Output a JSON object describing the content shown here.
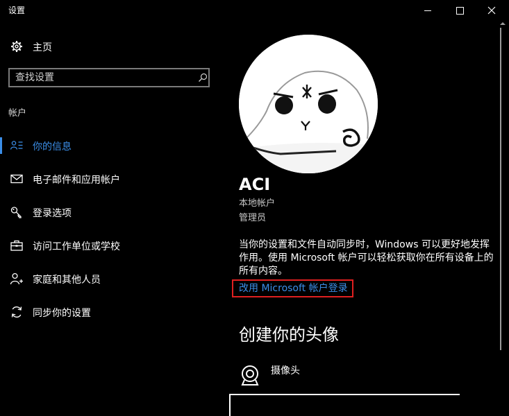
{
  "window": {
    "title": "设置"
  },
  "sidebar": {
    "home_label": "主页",
    "search": {
      "placeholder": "查找设置",
      "icon": "search-icon"
    },
    "section_title": "帐户",
    "items": [
      {
        "label": "你的信息",
        "icon": "person-card-icon",
        "active": true
      },
      {
        "label": "电子邮件和应用帐户",
        "icon": "mail-icon",
        "active": false
      },
      {
        "label": "登录选项",
        "icon": "key-icon",
        "active": false
      },
      {
        "label": "访问工作单位或学校",
        "icon": "briefcase-icon",
        "active": false
      },
      {
        "label": "家庭和其他人员",
        "icon": "person-add-icon",
        "active": false
      },
      {
        "label": "同步你的设置",
        "icon": "sync-icon",
        "active": false
      }
    ]
  },
  "main": {
    "account_name": "ACI",
    "account_type": "本地帐户",
    "account_role": "管理员",
    "sync_info": "当你的设置和文件自动同步时，Windows 可以更好地发挥作用。使用 Microsoft 帐户可以轻松获取你在所有设备上的所有内容。",
    "ms_login_link": "改用 Microsoft 帐户登录",
    "create_avatar_title": "创建你的头像",
    "camera_label": "摄像头"
  },
  "colors": {
    "background": "#000000",
    "accent": "#3b8ee8",
    "highlight_border": "#e02020"
  }
}
